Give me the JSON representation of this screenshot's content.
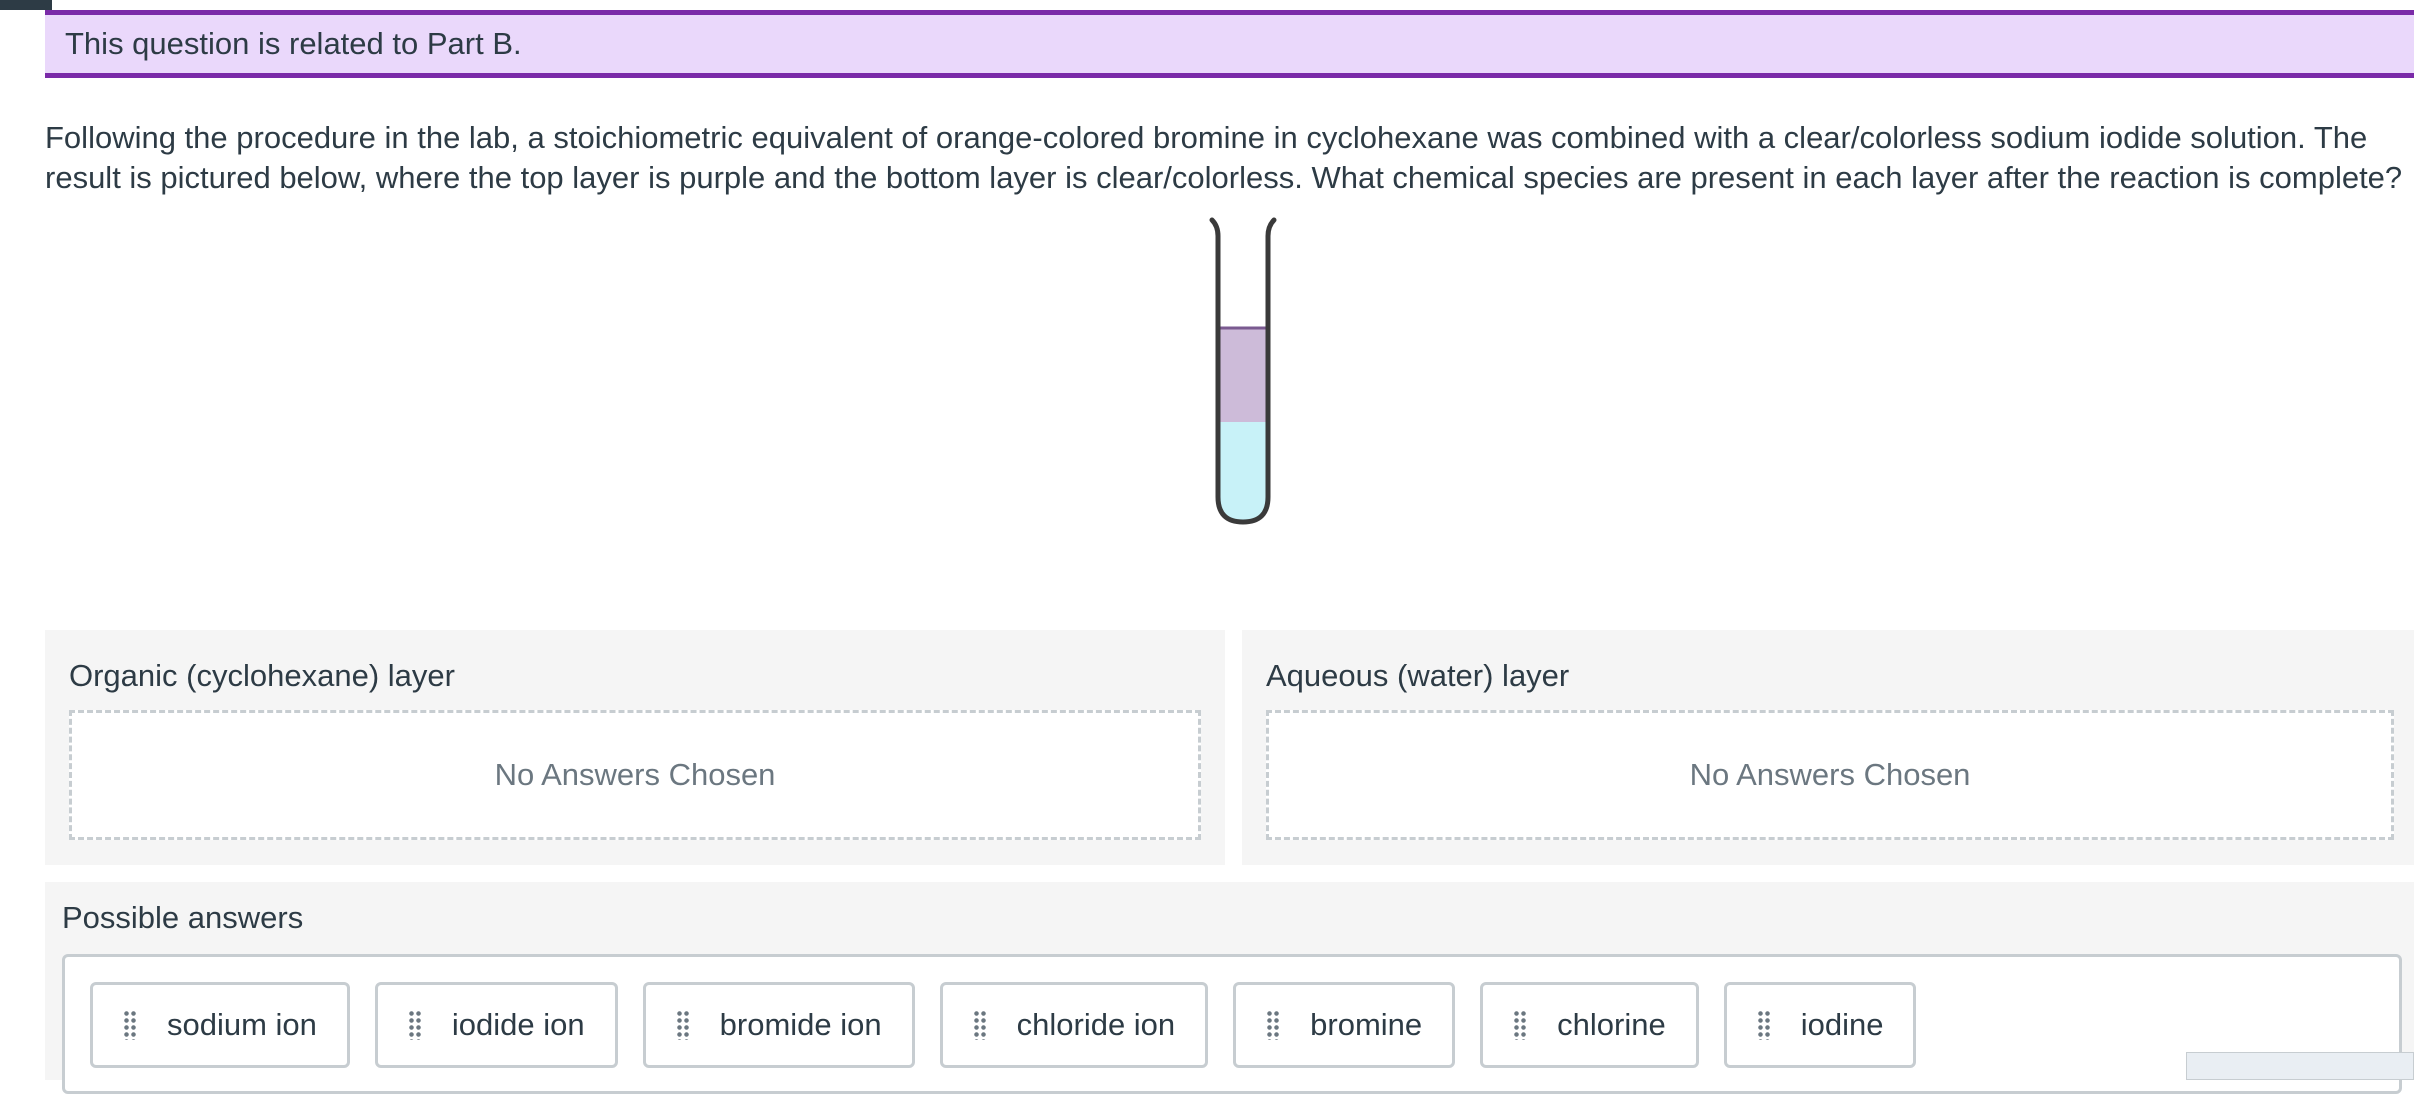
{
  "banner": {
    "text": "This question is related to Part B."
  },
  "question": {
    "line1": "Following the procedure in the lab, a stoichiometric equivalent of orange-colored bromine in cyclohexane was combined with a clear/colorless sodium iodide solution. The",
    "line2": "result is pictured below, where the top layer is purple and the bottom layer is clear/colorless. What chemical species are present in each layer after the reaction is complete?"
  },
  "tube": {
    "top_layer_color": "#cdbbd9",
    "bottom_layer_color": "#c8f2f8",
    "glass_color": "#3a3a3a"
  },
  "organic": {
    "title": "Organic (cyclohexane) layer",
    "empty_text": "No Answers Chosen"
  },
  "aqueous": {
    "title": "Aqueous (water) layer",
    "empty_text": "No Answers Chosen"
  },
  "answers": {
    "title": "Possible answers",
    "items": [
      "sodium ion",
      "iodide ion",
      "bromide ion",
      "chloride ion",
      "bromine",
      "chlorine",
      "iodine"
    ]
  },
  "colors": {
    "accent": "#7a2aa8",
    "banner_bg": "#ead8fb",
    "panel_bg": "#f5f5f5",
    "border": "#c7cdd1"
  }
}
